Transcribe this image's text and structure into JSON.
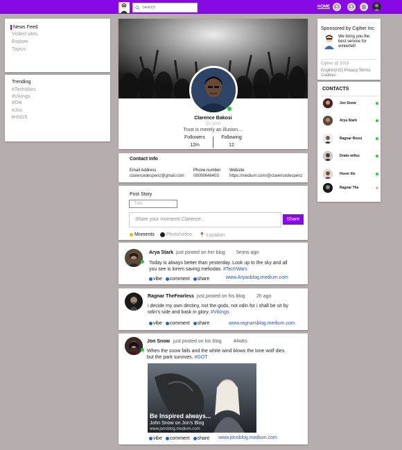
{
  "header": {
    "search_placeholder": "Search",
    "home_label": "HOME",
    "icons": [
      "messages-icon",
      "friends-icon",
      "notifications-icon"
    ],
    "brand_color": "#8808e6"
  },
  "nav": {
    "items": [
      {
        "label": "News Feed",
        "active": true
      },
      {
        "label": "Visited sites",
        "active": false
      },
      {
        "label": "Explore",
        "active": false
      },
      {
        "label": "Topics",
        "active": false
      }
    ]
  },
  "trending": {
    "title": "Trending",
    "tags": [
      "#TechWars",
      "#Vikings",
      "#Ole",
      "#Jon",
      "#HNG5"
    ]
  },
  "profile": {
    "name": "Clarence Bakosi",
    "handle": "@c.pher",
    "bio": "Trust is merely an illusion....",
    "followers_label": "Followers",
    "followers_value": "12m",
    "following_label": "Following",
    "following_value": "12"
  },
  "contact_info": {
    "title": "Contact Info",
    "email_label": "Email Address",
    "email_value": "clarencedespenz@gmail.com",
    "phone_label": "Phone number",
    "phone_value": "08099646403",
    "website_label": "Website",
    "website_value": "https://medium.com/@clarencedespenz"
  },
  "post_story": {
    "title": "Post Story",
    "title_placeholder": "Title",
    "moments_placeholder": "Share your moments Clarence...",
    "share_label": "Share",
    "options": {
      "moments": "Moments",
      "photo": "Photo/video",
      "location": "Location"
    }
  },
  "feed": [
    {
      "name": "Arya Stark",
      "action": "just posted on her blog",
      "time": "5mins ago",
      "text": "Today is always better than yesterday. Look up to the sky and all you see is lorem saving meliodas.",
      "hashtag": "#TechWars",
      "link": "www.Aryasblog.medium.com",
      "online": true
    },
    {
      "name": "Ragnar TheFearless",
      "action": "just posted on his blog",
      "time": "2h ago",
      "text": "i decide my own destiny,  not  the gods, not odin for i shall be sit by odin's side and bask in glory.",
      "hashtag": "#Vikings",
      "link": "www.ragnarsblog.medium.com",
      "online": false
    },
    {
      "name": "Jon Snow",
      "action": "just posted on his blog",
      "time": "44wks",
      "text": "When the snow falls and the white wind blows the lone wolf dies but the park survives.",
      "hashtag": "#GOT",
      "link": "www.jonsblog.medium.com",
      "online": true,
      "image": {
        "caption_title": "Be Inspired always...",
        "caption_sub": "John Snow on Jon's Blog",
        "caption_url": "www.jonsblog.medium.com"
      }
    }
  ],
  "post_actions": {
    "vibe": "vibe",
    "comment": "comment",
    "share": "share"
  },
  "sponsor": {
    "title": "Sponsored by Cipher Inc",
    "text": "We bring you the best service for winterfell!",
    "copyright": "Cipher @ 2019",
    "links": "English(US)  Privacy Terms",
    "cookies": "Cookies"
  },
  "contacts": {
    "title": "CONTACTS",
    "items": [
      {
        "name": "Jon Snow",
        "online": true
      },
      {
        "name": "Arya Stark",
        "online": true
      },
      {
        "name": "Ragnar Rossi",
        "online": true
      },
      {
        "name": "Drake willss",
        "online": true
      },
      {
        "name": "Hover illx",
        "online": true
      },
      {
        "name": "Ragnar The",
        "online": false
      }
    ],
    "online_color": "#19d62b",
    "offline_color": "#bdbdbd"
  }
}
